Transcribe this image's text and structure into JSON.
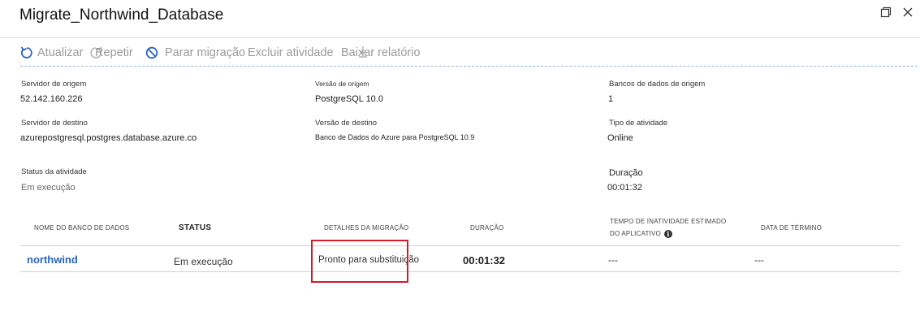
{
  "window": {
    "title": "Migrate_Northwind_Database",
    "restore_icon": "restore-window-icon",
    "close_icon": "close-icon"
  },
  "toolbar": {
    "refresh_label": "Atualizar",
    "retry_label": "Repetir",
    "stop_label": "Parar migração",
    "delete_label": "Excluir atividade",
    "download_label": "Baixar relatório"
  },
  "properties": {
    "source_server_label": "Servidor de origem",
    "source_server_value": "52.142.160.226",
    "source_version_label": "Versão de origem",
    "source_version_value": "PostgreSQL 10.0",
    "source_databases_label": "Bancos de dados de origem",
    "source_databases_value": "1",
    "target_server_label": "Servidor de destino",
    "target_server_value": "azurepostgresql.postgres.database.azure.com",
    "target_version_label": "Versão de destino",
    "target_version_value": "Banco de Dados do Azure para PostgreSQL 10.9",
    "activity_type_label": "Tipo de atividade",
    "activity_type_value": "Online",
    "activity_status_label": "Status da atividade",
    "activity_status_value": "Em execução",
    "duration_label": "Duração",
    "duration_value": "00:01:32"
  },
  "table": {
    "columns": {
      "db_name": "NOME DO BANCO DE DADOS",
      "status": "STATUS",
      "details": "DETALHES DA MIGRAÇÃO",
      "duration": "DURAÇÃO",
      "downtime_line1": "TEMPO DE INATIVIDADE ESTIMADO",
      "downtime_line2": "DO APLICATIVO",
      "end_date": "DATA DE TÉRMINO"
    },
    "rows": [
      {
        "db_name": "northwind",
        "status": "Em execução",
        "details": "Pronto para substituição",
        "duration": "00:01:32",
        "downtime": "---",
        "end_date": "---"
      }
    ]
  },
  "colors": {
    "link": "#2a63c5",
    "highlight": "#d11a2a",
    "toolbar_disabled": "#9a9a9a"
  }
}
